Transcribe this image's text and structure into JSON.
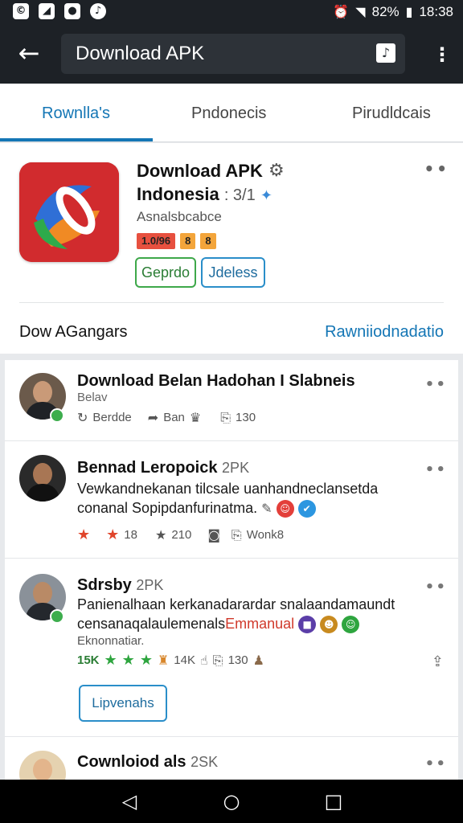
{
  "status_bar": {
    "left_icons": [
      "notification-icon",
      "image-icon",
      "camera-icon",
      "audio-icon"
    ],
    "battery": "82%",
    "time": "18:38"
  },
  "app_bar": {
    "search_text": "Download APK"
  },
  "tabs": [
    {
      "label": "Rownlla's"
    },
    {
      "label": "Pndonecis"
    },
    {
      "label": "Pirudldcais"
    }
  ],
  "app_card": {
    "title_line1": "Download APK",
    "title_line2": "Indonesia",
    "rating": ": 3/1",
    "subtitle": "Asnalsbcabce",
    "badge1": "1.0/96",
    "badge2": "8",
    "badge3": "8",
    "button_green": "Geprdo",
    "button_blue": "Jdeless",
    "left_link": "Dow AGangars",
    "right_link": "Rawniiodnadatio"
  },
  "posts": [
    {
      "title": "Download Belan Hadohan I Slabneis",
      "subtitle": "Belav",
      "action1": "Berdde",
      "action2": "Ban",
      "action3": "130"
    },
    {
      "title": "Bennad Leropoick",
      "meta": "2PK",
      "body_line1": "Vewkandnekanan tilcsale uanhandneclansetda",
      "body_line2": "conanal Sopipdanfurinatma.",
      "stat1": "18",
      "stat2": "210",
      "stat3": "Wonk8"
    },
    {
      "title": "Sdrsby",
      "meta": "2PK",
      "body_line1": "Panienalhaan kerkanadarardar snalaandamaundt",
      "body_line2": "censanaqalaulemenals",
      "body_highlight": "Emmanual",
      "body_line3": "Eknonnatiar.",
      "stat1": "15K",
      "stat2": "14K",
      "stat3": "130",
      "button_label": "Lipvenahs"
    },
    {
      "title": "Cownloiod als",
      "meta": "2SK"
    }
  ],
  "colors": {
    "accent": "#1476b5",
    "appbar": "#1d2126",
    "green": "#3ea84a",
    "red": "#e0452b"
  }
}
